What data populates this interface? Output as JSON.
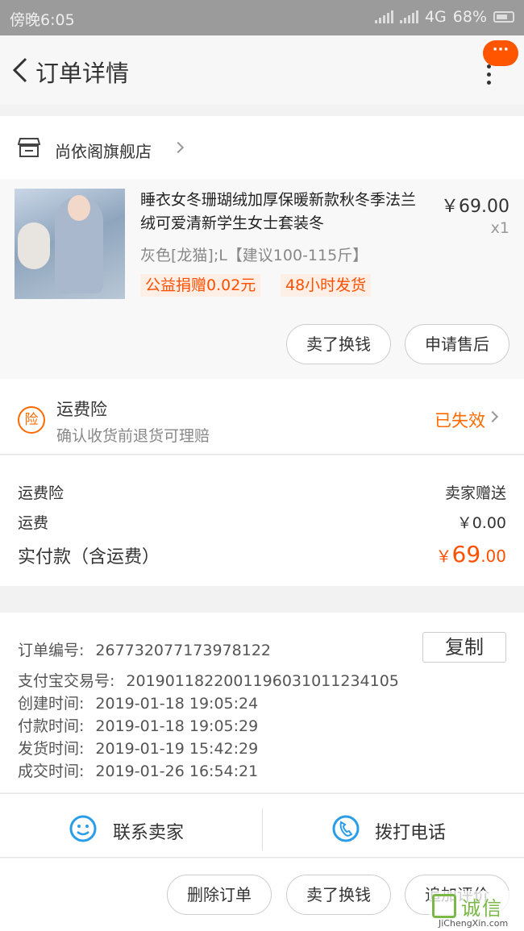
{
  "status_bar": {
    "time": "傍晚6:05",
    "network": "4G",
    "battery": "68%"
  },
  "nav": {
    "title": "订单详情"
  },
  "shop": {
    "name": "尚依阁旗舰店"
  },
  "item": {
    "title": "睡衣女冬珊瑚绒加厚保暖新款秋冬季法兰绒可爱清新学生女士套装冬",
    "sku": "灰色[龙猫];L【建议100-115斤】",
    "tags": [
      "公益捐赠0.02元",
      "48小时发货"
    ],
    "price": "￥69.00",
    "qty": "x1",
    "actions": [
      "卖了换钱",
      "申请售后"
    ]
  },
  "insurance": {
    "icon_char": "险",
    "title": "运费险",
    "subtitle": "确认收货前退货可理赔",
    "status": "已失效"
  },
  "fees": {
    "rows": [
      {
        "label": "运费险",
        "value": "卖家赠送"
      },
      {
        "label": "运费",
        "value": "￥0.00"
      }
    ],
    "total_label": "实付款（含运费）",
    "total_currency": "￥",
    "total_int": "69",
    "total_dec": ".00"
  },
  "order_info": {
    "copy_label": "复制",
    "rows": [
      {
        "label": "订单编号:",
        "value": "267732077173978122"
      },
      {
        "label": "支付宝交易号:",
        "value": "2019011822001196031011234105"
      },
      {
        "label": "创建时间:",
        "value": "2019-01-18 19:05:24"
      },
      {
        "label": "付款时间:",
        "value": "2019-01-18 19:05:29"
      },
      {
        "label": "发货时间:",
        "value": "2019-01-19 15:42:29"
      },
      {
        "label": "成交时间:",
        "value": "2019-01-26 16:54:21"
      }
    ]
  },
  "contact": {
    "seller": "联系卖家",
    "phone": "拨打电话"
  },
  "bottom": {
    "actions": [
      "删除订单",
      "卖了换钱",
      "追加评价"
    ]
  },
  "watermark": {
    "cn": "诚信",
    "en": "JiChengXin.com"
  },
  "colors": {
    "accent": "#ff5000",
    "blue": "#2a9de8",
    "status_bar": "#9b9b9b"
  }
}
